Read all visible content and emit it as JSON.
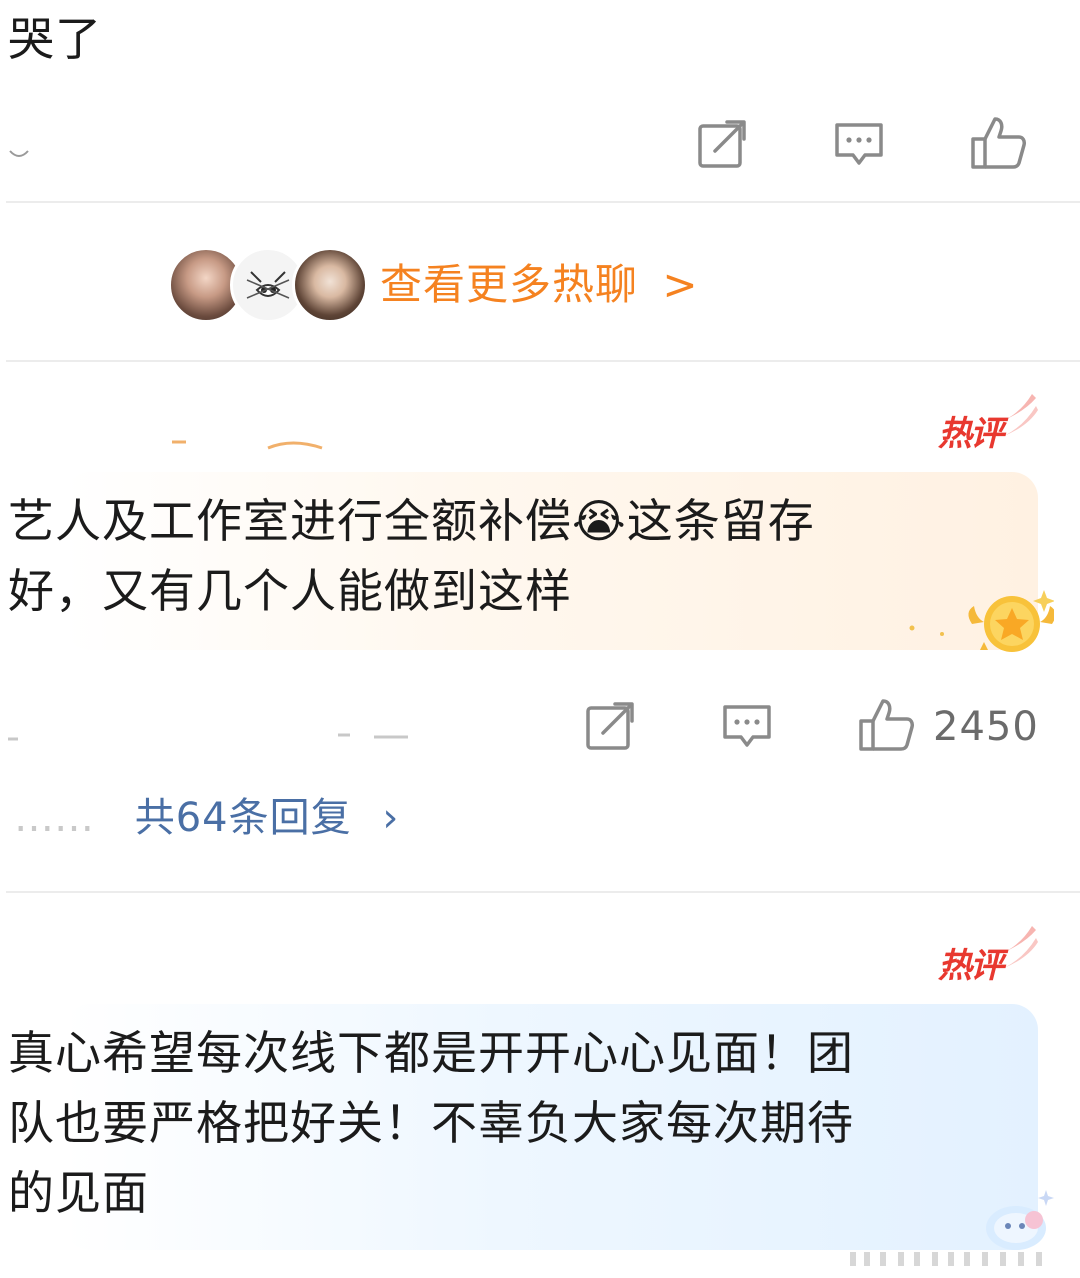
{
  "top_comment": {
    "text": "哭了",
    "icons": [
      "share-icon",
      "comment-icon",
      "like-icon"
    ]
  },
  "more_hot_chat": {
    "label": "查看更多热聊",
    "chevron": ">",
    "color": "#f58220"
  },
  "comment1": {
    "badge": "热评",
    "text_line1": "艺人及工作室进行全额补偿",
    "emoji": "😭",
    "text_line1b": "这条留存",
    "text_line2": "好，又有几个人能做到这样",
    "like_count": "2450",
    "replies_dots": "……",
    "replies_label": "共64条回复",
    "replies_chevron": "›"
  },
  "comment2": {
    "badge": "热评",
    "text_line1": "真心希望每次线下都是开开心心见面！团",
    "text_line2": "队也要严格把好关！不辜负大家每次期待",
    "text_line3": "的见面"
  },
  "colors": {
    "accent_orange": "#f58220",
    "hot_red": "#e8382f",
    "reply_blue": "#4a6fa5",
    "icon_gray": "#8a8a8a"
  }
}
